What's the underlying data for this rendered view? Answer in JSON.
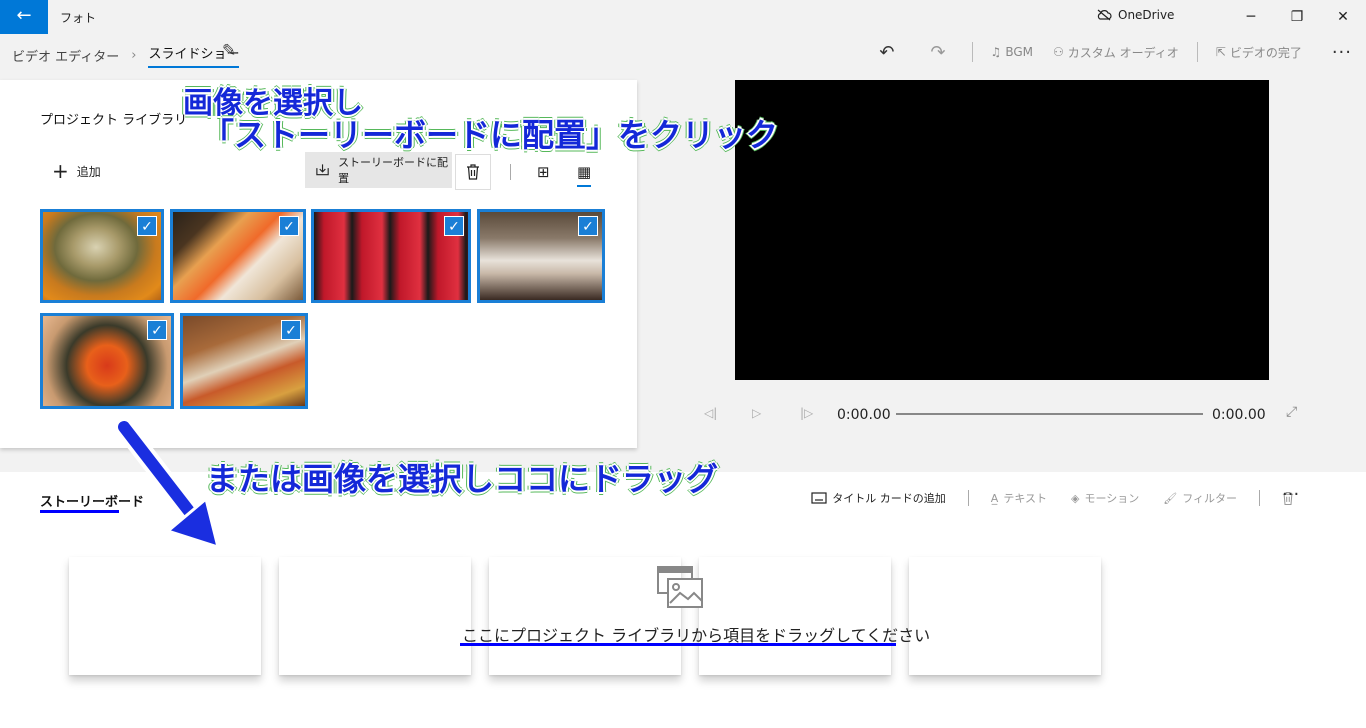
{
  "window": {
    "app_title": "フォト",
    "onedrive_label": "OneDrive"
  },
  "breadcrumb": {
    "items": [
      "ビデオ エディター",
      "スライドショー"
    ]
  },
  "toolbar": {
    "bgm_label": "BGM",
    "custom_audio_label": "カスタム オーディオ",
    "finish_video_label": "ビデオの完了"
  },
  "library": {
    "title": "プロジェクト ライブラリ",
    "add_label": "追加",
    "place_in_storyboard_label": "ストーリーボードに配置"
  },
  "thumbnails": [
    {
      "subject": "seared fish sushi",
      "selected": true
    },
    {
      "subject": "sea urchin and roe sushi",
      "selected": true
    },
    {
      "subject": "tuna maki rolls",
      "selected": true
    },
    {
      "subject": "sushi counter",
      "selected": true
    },
    {
      "subject": "salmon roe gunkan",
      "selected": true
    },
    {
      "subject": "sushi platter with beer",
      "selected": true
    }
  ],
  "player": {
    "current_time": "0:00.00",
    "total_time": "0:00.00"
  },
  "storyboard": {
    "title": "ストーリーボード",
    "title_card_label": "タイトル カードの追加",
    "text_label": "テキスト",
    "motion_label": "モーション",
    "filter_label": "フィルター",
    "drop_hint": "ここにプロジェクト ライブラリから項目をドラッグしてください"
  },
  "annotations": {
    "line1": "画像を選択し",
    "line2": "「ストーリーボードに配置」をクリック",
    "line3": "または画像を選択しココにドラッグ"
  },
  "colors": {
    "accent": "#0078d7",
    "annotation_text": "#1428d8",
    "annotation_arrow": "#1a2ee0",
    "annotation_outline": "#56b85a"
  }
}
